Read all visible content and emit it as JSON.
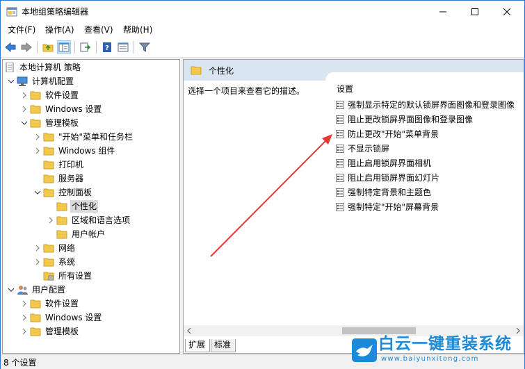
{
  "window": {
    "title": "本地组策略编辑器"
  },
  "menu": [
    "文件(F)",
    "操作(A)",
    "查看(V)",
    "帮助(H)"
  ],
  "toolbar": {
    "icons": [
      "back-icon",
      "forward-icon",
      "up-folder-icon",
      "show-hide-tree-icon",
      "export-list-icon",
      "help-icon",
      "properties-icon",
      "filter-icon"
    ]
  },
  "tree": {
    "root": "本地计算机 策略",
    "items": [
      "计算机配置",
      "软件设置",
      "Windows 设置",
      "管理模板",
      "\"开始\"菜单和任务栏",
      "Windows 组件",
      "打印机",
      "服务器",
      "控制面板",
      "个性化",
      "区域和语言选项",
      "用户帐户",
      "网络",
      "系统",
      "所有设置",
      "用户配置",
      "软件设置",
      "Windows 设置",
      "管理模板"
    ]
  },
  "right_pane": {
    "header": "个性化",
    "description": "选择一个项目来查看它的描述。",
    "list_header": "设置",
    "policies": [
      "强制显示特定的默认锁屏界面图像和登录图像",
      "阻止更改锁屏界面图像和登录图像",
      "防止更改\"开始\"菜单背景",
      "不显示锁屏",
      "阻止启用锁屏界面相机",
      "阻止启用锁屏界面幻灯片",
      "强制特定背景和主题色",
      "强制特定\"开始\"屏幕背景"
    ]
  },
  "tabs": [
    "扩展",
    "标准"
  ],
  "status": "8 个设置",
  "watermark": {
    "brand": "白云一键重装系统",
    "url": "www.baiyunxitong.com"
  },
  "colors": {
    "accent": "#1c8ad9",
    "annotation_arrow": "#e53935",
    "folder": "#f2c94c"
  }
}
